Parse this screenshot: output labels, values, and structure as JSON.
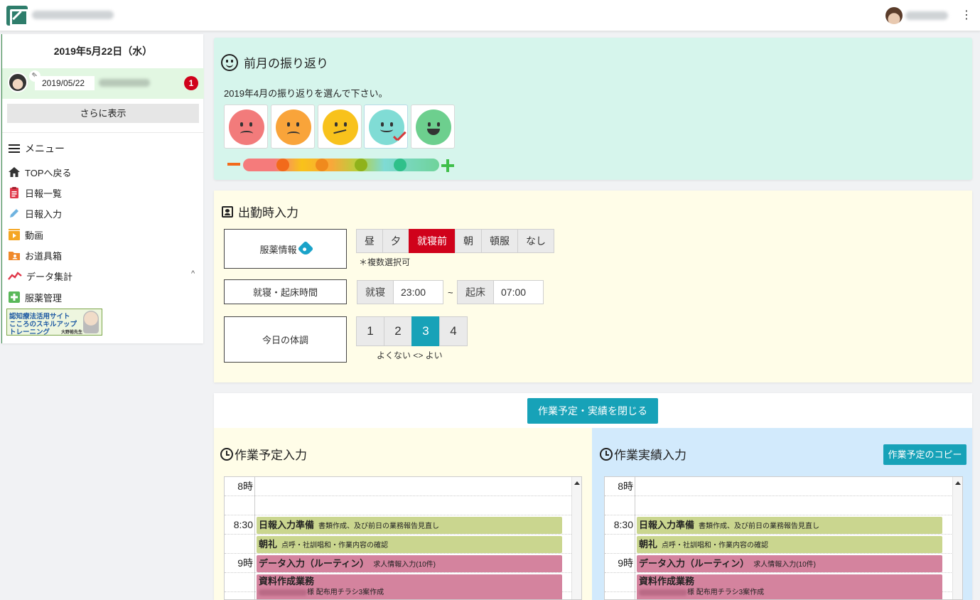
{
  "header": {
    "menu_glyph": "⋮"
  },
  "sidebar": {
    "date": "2019年5月22日（水）",
    "user_date": "2019/05/22",
    "badge_count": "1",
    "more_label": "さらに表示",
    "menu_title": "メニュー",
    "items": [
      {
        "label": "TOPへ戻る",
        "icon": "home-icon",
        "color": "#333333"
      },
      {
        "label": "日報一覧",
        "icon": "clipboard-icon",
        "color": "#e0384a"
      },
      {
        "label": "日報入力",
        "icon": "pencil-icon",
        "color": "#6fb3e0"
      },
      {
        "label": "動画",
        "icon": "video-icon",
        "color": "#f5a623"
      },
      {
        "label": "お道具箱",
        "icon": "toolbox-icon",
        "color": "#f0892b"
      },
      {
        "label": "データ集計",
        "icon": "chart-icon",
        "color": "#e0384a"
      },
      {
        "label": "服薬管理",
        "icon": "plus-square-icon",
        "color": "#59b859"
      }
    ],
    "banner": {
      "line1": "認知療法活用サイト",
      "line2": "こころのスキルアップ",
      "line3": "トレーニング",
      "line4": "大野裕先生"
    }
  },
  "reflection": {
    "title": "前月の振り返り",
    "prompt": "2019年4月の振り返りを選んで下さい。",
    "faces": [
      {
        "mood": "very-bad",
        "color": "#f27b7b",
        "selected": false
      },
      {
        "mood": "bad",
        "color": "#f9a43a",
        "selected": false
      },
      {
        "mood": "neutral",
        "color": "#f8c21c",
        "selected": false
      },
      {
        "mood": "good",
        "color": "#80dcd5",
        "selected": true
      },
      {
        "mood": "very-good",
        "color": "#6dcf8e",
        "selected": false
      }
    ],
    "scale_colors": {
      "minus": "#f26a1b",
      "plus": "#3fbf4a"
    }
  },
  "attendance": {
    "title": "出勤時入力",
    "medication": {
      "label": "服薬情報",
      "options": [
        "昼",
        "夕",
        "就寝前",
        "朝",
        "頓服",
        "なし"
      ],
      "selected": "就寝前",
      "note": "＊複数選択可"
    },
    "sleep": {
      "label": "就寝・起床時間",
      "bed_label": "就寝",
      "bed_time": "23:00",
      "separator": "~",
      "wake_label": "起床",
      "wake_time": "07:00"
    },
    "condition": {
      "label": "今日の体調",
      "options": [
        "1",
        "2",
        "3",
        "4"
      ],
      "selected": "3",
      "note": "よくない <> よい"
    }
  },
  "work": {
    "close_button": "作業予定・実績を閉じる",
    "plan_title": "作業予定入力",
    "actual_title": "作業実績入力",
    "copy_button": "作業予定のコピー",
    "time_labels": [
      "8時",
      "",
      "8:30",
      "",
      "9時",
      ""
    ],
    "events": [
      {
        "title": "日報入力準備",
        "desc": "書類作成、及び前日の業務報告見直し",
        "type": "green"
      },
      {
        "title": "朝礼",
        "desc": "点呼・社訓唱和・作業内容の確認",
        "type": "green"
      },
      {
        "title": "データ入力（ルーティン）",
        "desc": "求人情報入力(10件)",
        "type": "pink"
      },
      {
        "title": "資料作成業務",
        "desc": "様 配布用チラシ3案作成",
        "type": "pink"
      }
    ]
  }
}
